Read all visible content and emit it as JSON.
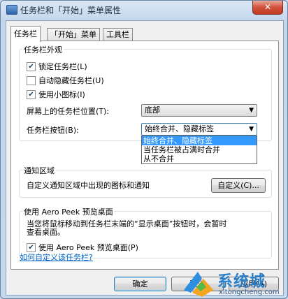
{
  "window": {
    "title": "任务栏和「开始」菜单属性",
    "close_label": "✕"
  },
  "tabs": [
    {
      "label": "任务栏",
      "active": true
    },
    {
      "label": "「开始」菜单",
      "active": false
    },
    {
      "label": "工具栏",
      "active": false
    }
  ],
  "appearance": {
    "title": "任务栏外观",
    "checkboxes": [
      {
        "label": "锁定任务栏(L)",
        "checked": true
      },
      {
        "label": "自动隐藏任务栏(U)",
        "checked": false
      },
      {
        "label": "使用小图标(I)",
        "checked": true
      }
    ],
    "position_label": "屏幕上的任务栏位置(T):",
    "position_value": "底部",
    "buttons_label": "任务栏按钮(B):",
    "buttons_value": "始终合并、隐藏标签",
    "buttons_options": [
      {
        "label": "始终合并、隐藏标签",
        "selected": true
      },
      {
        "label": "当任务栏被占满时合并",
        "selected": false
      },
      {
        "label": "从不合并",
        "selected": false
      }
    ]
  },
  "notify": {
    "title": "通知区域",
    "text": "自定义通知区域中出现的图标和通知",
    "button": "自定义(C)..."
  },
  "aero": {
    "title": "使用 Aero Peek 预览桌面",
    "description_line1": "当您将鼠标移动到任务栏末端的“显示桌面”按钮时，会暂时",
    "description_line2": "查看桌面。",
    "checkbox": {
      "label": "使用 Aero Peek 预览桌面(P)",
      "checked": true
    }
  },
  "help_link": "如何自定义该任务栏?",
  "footer": {
    "ok": "确定",
    "cancel": "取消",
    "apply": "应用(A)"
  },
  "watermark": {
    "name": "系统城",
    "url": "xitongcheng.com"
  },
  "colors": {
    "selection": "#3399ff",
    "link": "#0066cc",
    "watermark": "#2a7fc9"
  }
}
